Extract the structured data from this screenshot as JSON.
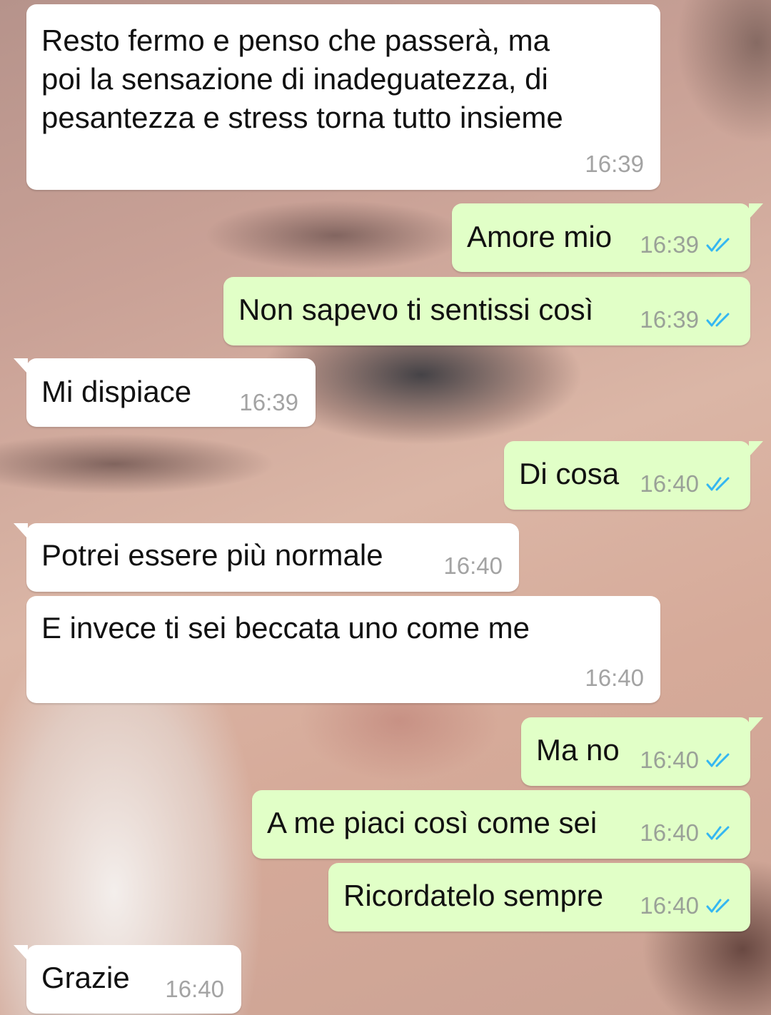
{
  "conversation": {
    "messages": [
      {
        "direction": "incoming",
        "text_lines": [
          "Resto fermo e penso che passerà, ma",
          "poi la sensazione di inadeguatezza, di",
          "pesantezza e stress torna tutto insieme"
        ],
        "time": "16:39"
      },
      {
        "direction": "outgoing",
        "text": "Amore mio",
        "time": "16:39",
        "status": "read"
      },
      {
        "direction": "outgoing",
        "text": "Non sapevo ti sentissi così",
        "time": "16:39",
        "status": "read"
      },
      {
        "direction": "incoming",
        "text": "Mi dispiace",
        "time": "16:39"
      },
      {
        "direction": "outgoing",
        "text": "Di cosa",
        "time": "16:40",
        "status": "read"
      },
      {
        "direction": "incoming",
        "text": "Potrei essere più normale",
        "time": "16:40"
      },
      {
        "direction": "incoming",
        "text": "E invece ti sei beccata uno come me",
        "time": "16:40"
      },
      {
        "direction": "outgoing",
        "text": "Ma no",
        "time": "16:40",
        "status": "read"
      },
      {
        "direction": "outgoing",
        "text": "A me piaci così come sei",
        "time": "16:40",
        "status": "read"
      },
      {
        "direction": "outgoing",
        "text": "Ricordatelo sempre",
        "time": "16:40",
        "status": "read"
      },
      {
        "direction": "incoming",
        "text": "Grazie",
        "time": "16:40"
      }
    ]
  },
  "colors": {
    "incoming_bubble": "#ffffff",
    "outgoing_bubble": "#e1ffc7",
    "read_ticks": "#34b7f1",
    "timestamp": "#9aa198"
  },
  "icons": {
    "read_status": "double-check-icon"
  }
}
